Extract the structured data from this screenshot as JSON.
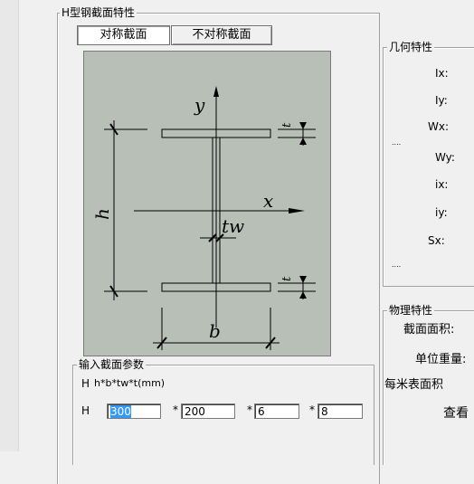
{
  "h_group": {
    "title": "H型钢截面特性",
    "tab_symmetric": "对称截面",
    "tab_asymmetric": "不对称截面"
  },
  "figure": {
    "label_y": "y",
    "label_x": "x",
    "label_h": "h",
    "label_b": "b",
    "label_tw": "tw",
    "label_t_top": "t",
    "label_t_bottom": "t"
  },
  "geometry_group": {
    "title": "几何特性",
    "items": [
      "Ix:",
      "Iy:",
      "Wx:",
      "....",
      "Wy:",
      "ix:",
      "iy:",
      "Sx:",
      "...."
    ]
  },
  "physical_group": {
    "title": "物理特性",
    "items": [
      "截面面积:",
      "单位重量:",
      "每米表面积",
      "查看"
    ]
  },
  "input_group": {
    "title": "输入截面参数",
    "type_label": "H",
    "formula": "h*b*tw*t(mm)",
    "row_label": "H",
    "h_value": "300",
    "b_value": "200",
    "tw_value": "6",
    "t_value": "8",
    "sep1": "*",
    "sep2": "*",
    "sep3": "*"
  }
}
